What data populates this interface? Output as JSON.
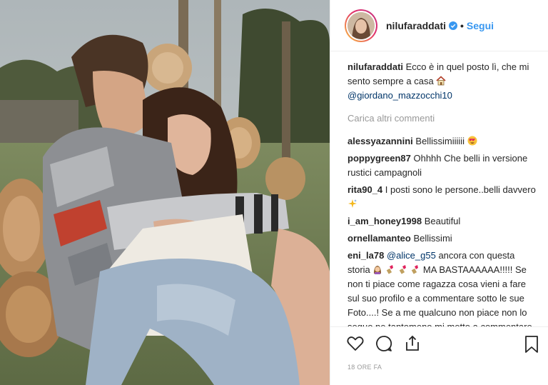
{
  "header": {
    "username": "nilufaraddati",
    "separator": "•",
    "follow_label": "Segui",
    "accent_color": "#3897f0",
    "verified_icon": "verified-badge-icon"
  },
  "caption": {
    "username": "nilufaraddati",
    "text": "Ecco è in quel posto lì, che mi sento sempre a casa",
    "emoji": "house-emoji",
    "mention": "@giordano_mazzocchi10"
  },
  "load_more_label": "Carica altri commenti",
  "comments": [
    {
      "user": "alessyazannini",
      "text": "Bellissimiiiiii",
      "emoji": "heart-eyes-emoji"
    },
    {
      "user": "poppygreen87",
      "text": "Ohhhh Che belli in versione rustici campagnoli"
    },
    {
      "user": "rita90_4",
      "text": "I posti sono le persone..belli davvero",
      "emoji": "sparkle-emoji"
    },
    {
      "user": "i_am_honey1998",
      "text": "Beautiful"
    },
    {
      "user": "ornellamanteo",
      "text": "Bellissimi"
    },
    {
      "user": "eni_la78",
      "mention": "@alice_g55",
      "text_1": "ancora con questa storia",
      "text_2": "MA BASTAAAAAA!!!!! Se non ti piace come ragazza cosa vieni a fare sul suo profilo e a commentare sotto le sue Foto....! Se a me qualcuno non piace non lo seguo ne tantomeno mi metto a commentare in negativo sotto le sue Foto... Peccato che instagram non viene usato"
    }
  ],
  "actions": {
    "like_icon": "heart-icon",
    "comment_icon": "comment-icon",
    "share_icon": "share-icon",
    "save_icon": "bookmark-icon"
  },
  "timestamp": "18 ORE FA"
}
